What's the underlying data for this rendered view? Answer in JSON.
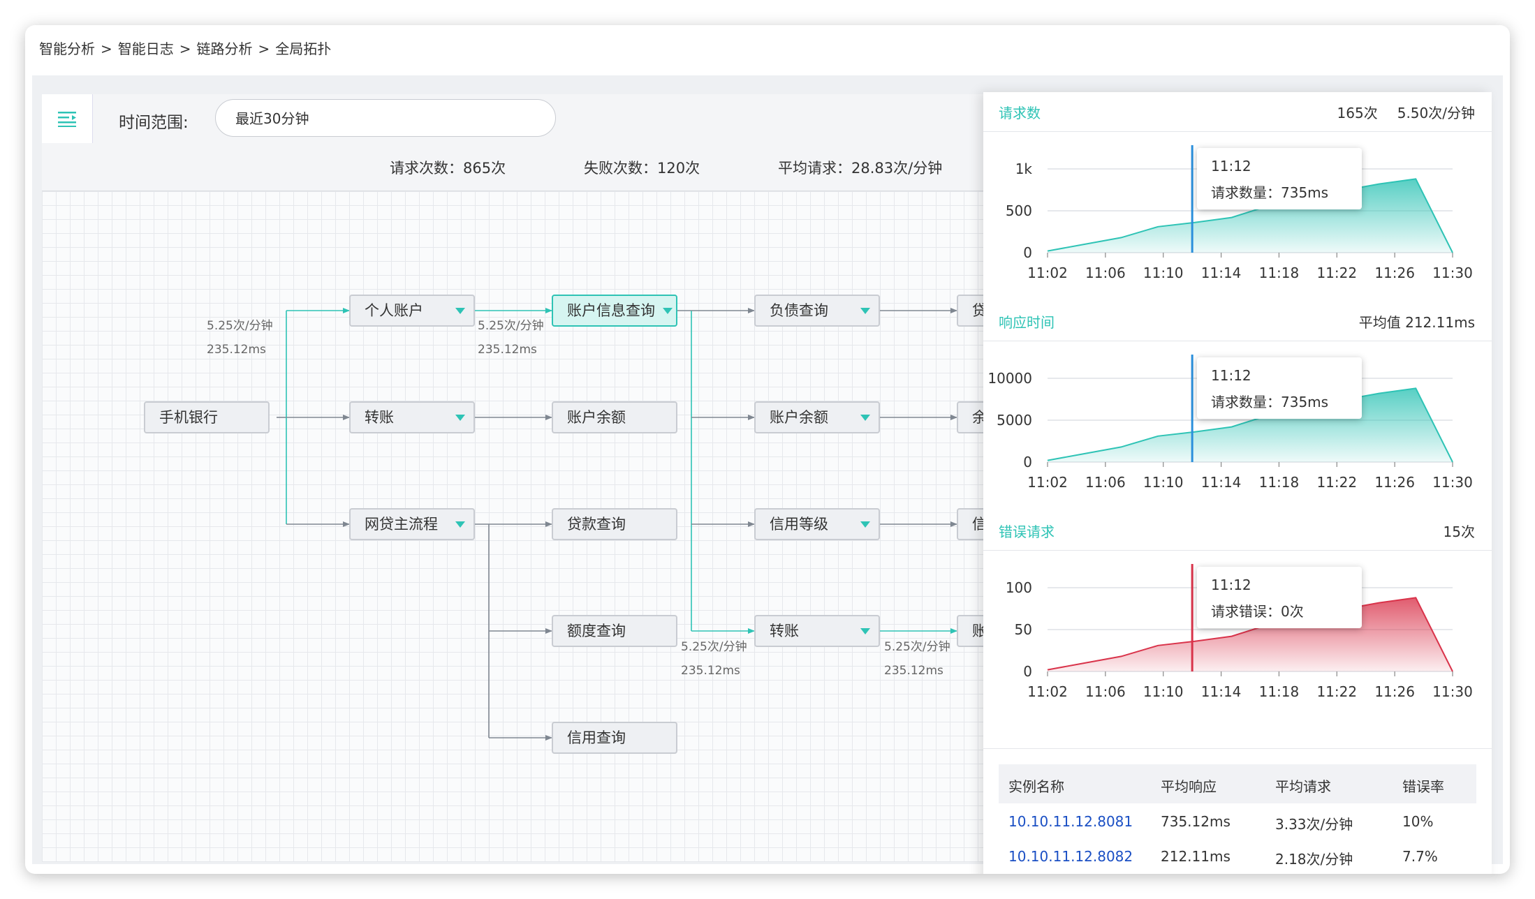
{
  "breadcrumb": [
    "智能分析",
    "智能日志",
    "链路分析",
    "全局拓扑"
  ],
  "breadcrumb_sep": ">",
  "filter": {
    "label": "时间范围:",
    "value": "最近30分钟"
  },
  "stats": {
    "requests": "请求次数：865次",
    "failures": "失败次数：120次",
    "avg": "平均请求：28.83次/分钟"
  },
  "nodes": {
    "mobile_bank": "手机银行",
    "personal_account": "个人账户",
    "transfer": "转账",
    "loan_main": "网贷主流程",
    "account_query": "账户信息查询",
    "account_balance": "账户余额",
    "loan_query": "贷款查询",
    "quota_query": "额度查询",
    "credit_query": "信用查询",
    "debt_query": "负债查询",
    "account_balance_2": "账户余额",
    "credit_level": "信用等级",
    "transfer_2": "转账",
    "partial_1": "贷",
    "partial_2": "余",
    "partial_3": "信",
    "partial_4": "账"
  },
  "flow_labels": [
    {
      "rate": "5.25次/分钟",
      "time": "235.12ms"
    },
    {
      "rate": "5.25次/分钟",
      "time": "235.12ms"
    },
    {
      "rate": "5.25次/分钟",
      "time": "235.12ms"
    },
    {
      "rate": "5.25次/分钟",
      "time": "235.12ms"
    }
  ],
  "panel": {
    "requests": {
      "title": "请求数",
      "count": "165次",
      "rate": "5.50次/分钟",
      "tooltip": {
        "time": "11:12",
        "text": "请求数量：735ms"
      }
    },
    "response": {
      "title": "响应时间",
      "avg": "平均值 212.11ms",
      "tooltip": {
        "time": "11:12",
        "text": "请求数量：735ms"
      }
    },
    "errors": {
      "title": "错误请求",
      "count": "15次",
      "tooltip": {
        "time": "11:12",
        "text": "请求错误：0次"
      }
    }
  },
  "chart_data": [
    {
      "type": "area",
      "title": "请求数",
      "color": "#2ec3b5",
      "x": [
        "11:02",
        "11:06",
        "11:10",
        "11:14",
        "11:18",
        "11:22",
        "11:26",
        "11:30"
      ],
      "yticks": [
        "0",
        "500",
        "1k"
      ],
      "ylim": [
        0,
        1000
      ],
      "values": [
        20,
        100,
        180,
        310,
        360,
        420,
        560,
        680,
        740,
        820,
        880,
        0
      ]
    },
    {
      "type": "area",
      "title": "响应时间",
      "color": "#2ec3b5",
      "x": [
        "11:02",
        "11:06",
        "11:10",
        "11:14",
        "11:18",
        "11:22",
        "11:26",
        "11:30"
      ],
      "yticks": [
        "0",
        "5000",
        "10000"
      ],
      "ylim": [
        0,
        10000
      ],
      "values": [
        200,
        1000,
        1800,
        3100,
        3600,
        4200,
        5600,
        6800,
        7400,
        8200,
        8800,
        0
      ]
    },
    {
      "type": "area",
      "title": "错误请求",
      "color": "#d9334a",
      "x": [
        "11:02",
        "11:06",
        "11:10",
        "11:14",
        "11:18",
        "11:22",
        "11:26",
        "11:30"
      ],
      "yticks": [
        "0",
        "50",
        "100"
      ],
      "ylim": [
        0,
        100
      ],
      "values": [
        2,
        10,
        18,
        31,
        36,
        42,
        56,
        68,
        74,
        82,
        88,
        0
      ]
    }
  ],
  "table": {
    "headers": [
      "实例名称",
      "平均响应",
      "平均请求",
      "错误率"
    ],
    "rows": [
      [
        "10.10.11.12.8081",
        "735.12ms",
        "3.33次/分钟",
        "10%"
      ],
      [
        "10.10.11.12.8082",
        "212.11ms",
        "2.18次/分钟",
        "7.7%"
      ]
    ]
  }
}
